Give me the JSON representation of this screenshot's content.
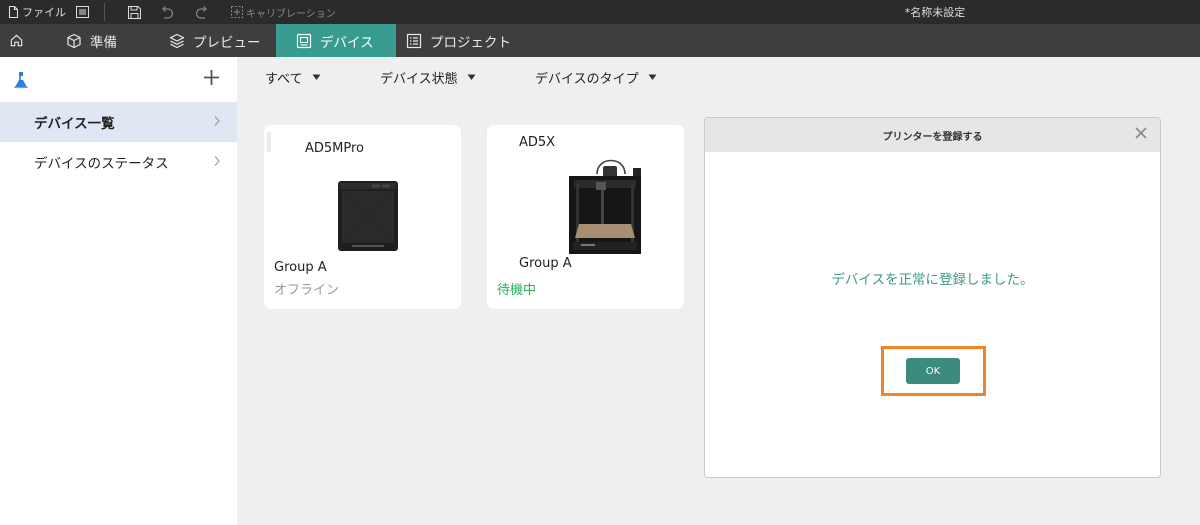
{
  "titlebar": {
    "file_menu": "ファイル",
    "calibration": "キャリブレーション",
    "document_title": "*名称未設定"
  },
  "tabs": [
    {
      "label": "準備",
      "icon": "cube-icon"
    },
    {
      "label": "プレビュー",
      "icon": "layers-icon"
    },
    {
      "label": "デバイス",
      "icon": "device-icon",
      "active": true
    },
    {
      "label": "プロジェクト",
      "icon": "list-icon"
    }
  ],
  "sidebar": {
    "items": [
      {
        "label": "デバイス一覧",
        "selected": true
      },
      {
        "label": "デバイスのステータス",
        "selected": false
      }
    ]
  },
  "filters": [
    {
      "label": "すべて"
    },
    {
      "label": "デバイス状態"
    },
    {
      "label": "デバイスのタイプ"
    }
  ],
  "devices": [
    {
      "model": "AD5MPro",
      "group": "Group A",
      "status": "オフライン",
      "status_color": "#9a9a9a"
    },
    {
      "model": "AD5X",
      "group": "Group A",
      "status": "待機中",
      "status_color": "#21b35a"
    }
  ],
  "dialog": {
    "title": "プリンターを登録する",
    "message": "デバイスを正常に登録しました。",
    "ok_label": "OK"
  },
  "colors": {
    "accent": "#379c8f",
    "ok_button": "#3d8a7f",
    "highlight_frame": "#f0842b",
    "titlebar_bg": "#2b2b2b",
    "tabbar_bg": "#3e3e3e"
  }
}
